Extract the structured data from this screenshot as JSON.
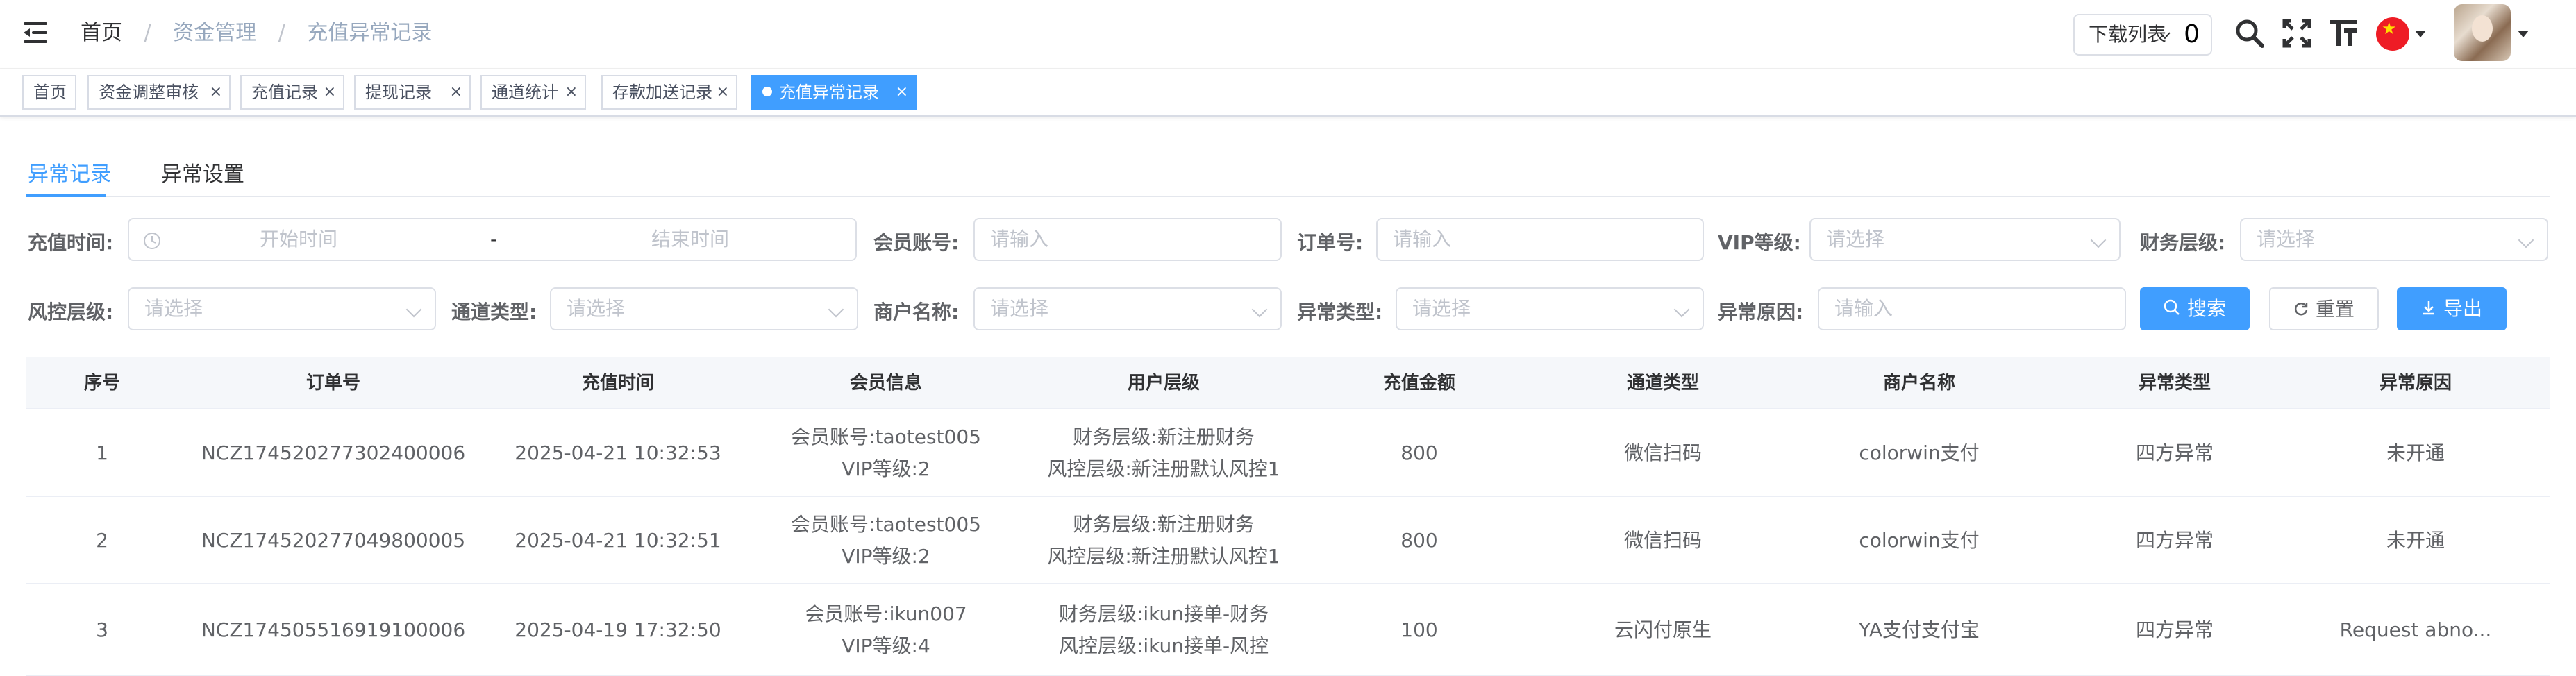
{
  "breadcrumb": {
    "home": "首页",
    "sep": "/",
    "level1": "资金管理",
    "level2": "充值异常记录"
  },
  "header": {
    "download_label": "下载列表",
    "download_count": "0"
  },
  "tags": [
    {
      "label": "首页",
      "closable": false,
      "active": false
    },
    {
      "label": "资金调整审核",
      "closable": true,
      "active": false
    },
    {
      "label": "充值记录",
      "closable": true,
      "active": false
    },
    {
      "label": "提现记录",
      "closable": true,
      "active": false
    },
    {
      "label": "通道统计",
      "closable": true,
      "active": false
    },
    {
      "label": "存款加送记录",
      "closable": true,
      "active": false
    },
    {
      "label": "充值异常记录",
      "closable": true,
      "active": true
    }
  ],
  "tabs": {
    "records": "异常记录",
    "settings": "异常设置"
  },
  "filters": {
    "recharge_time": {
      "label": "充值时间:",
      "start": "开始时间",
      "sep": "-",
      "end": "结束时间"
    },
    "member_account": {
      "label": "会员账号:",
      "placeholder": "请输入"
    },
    "order_no": {
      "label": "订单号:",
      "placeholder": "请输入"
    },
    "vip_level": {
      "label": "VIP等级:",
      "placeholder": "请选择"
    },
    "finance_level": {
      "label": "财务层级:",
      "placeholder": "请选择"
    },
    "risk_level": {
      "label": "风控层级:",
      "placeholder": "请选择"
    },
    "channel_type": {
      "label": "通道类型:",
      "placeholder": "请选择"
    },
    "merchant_name": {
      "label": "商户名称:",
      "placeholder": "请选择"
    },
    "anomaly_type": {
      "label": "异常类型:",
      "placeholder": "请选择"
    },
    "anomaly_reason": {
      "label": "异常原因:",
      "placeholder": "请输入"
    }
  },
  "buttons": {
    "search": "搜索",
    "reset": "重置",
    "export": "导出"
  },
  "table": {
    "columns": [
      "序号",
      "订单号",
      "充值时间",
      "会员信息",
      "用户层级",
      "充值金额",
      "通道类型",
      "商户名称",
      "异常类型",
      "异常原因"
    ],
    "rows": [
      {
        "index": "1",
        "order": "NCZ174520277302400006",
        "time": "2025-04-21 10:32:53",
        "member": "会员账号:taotest005",
        "vip": "VIP等级:2",
        "finance": "财务层级:新注册财务",
        "risk": "风控层级:新注册默认风控1",
        "amount": "800",
        "channel": "微信扫码",
        "merchant": "colorwin支付",
        "type": "四方异常",
        "reason": "未开通"
      },
      {
        "index": "2",
        "order": "NCZ174520277049800005",
        "time": "2025-04-21 10:32:51",
        "member": "会员账号:taotest005",
        "vip": "VIP等级:2",
        "finance": "财务层级:新注册财务",
        "risk": "风控层级:新注册默认风控1",
        "amount": "800",
        "channel": "微信扫码",
        "merchant": "colorwin支付",
        "type": "四方异常",
        "reason": "未开通"
      },
      {
        "index": "3",
        "order": "NCZ174505516919100006",
        "time": "2025-04-19 17:32:50",
        "member": "会员账号:ikun007",
        "vip": "VIP等级:4",
        "finance": "财务层级:ikun接单-财务",
        "risk": "风控层级:ikun接单-风控",
        "amount": "100",
        "channel": "云闪付原生",
        "merchant": "YA支付支付宝",
        "type": "四方异常",
        "reason": "Request abno..."
      }
    ]
  },
  "colors": {
    "primary": "#409eff",
    "breadcrumb_link": "#97a8be",
    "text": "#303133",
    "muted": "#c0c4cc"
  },
  "icons": {
    "menu": "hamburger-icon",
    "search": "search-icon",
    "fullscreen": "fullscreen-icon",
    "font_size": "font-size-icon",
    "language": "china-flag-icon",
    "avatar": "avatar-image"
  }
}
